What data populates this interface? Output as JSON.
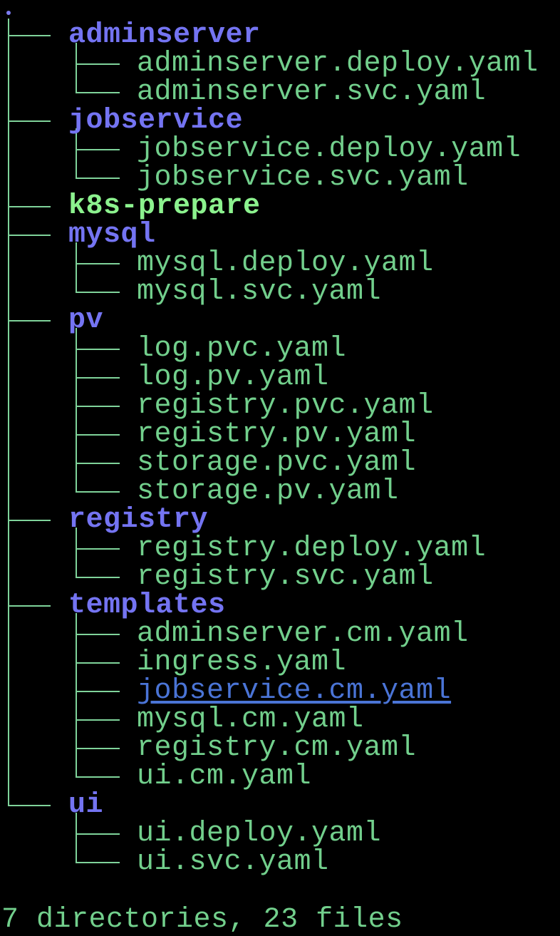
{
  "tree": {
    "root": ".",
    "entries": [
      {
        "depth": 0,
        "name": "adminserver",
        "kind": "dir",
        "last": false
      },
      {
        "depth": 1,
        "name": "adminserver.deploy.yaml",
        "kind": "file",
        "last": false
      },
      {
        "depth": 1,
        "name": "adminserver.svc.yaml",
        "kind": "file",
        "last": true
      },
      {
        "depth": 0,
        "name": "jobservice",
        "kind": "dir",
        "last": false
      },
      {
        "depth": 1,
        "name": "jobservice.deploy.yaml",
        "kind": "file",
        "last": false
      },
      {
        "depth": 1,
        "name": "jobservice.svc.yaml",
        "kind": "file",
        "last": true
      },
      {
        "depth": 0,
        "name": "k8s-prepare",
        "kind": "exec",
        "last": false
      },
      {
        "depth": 0,
        "name": "mysql",
        "kind": "dir",
        "last": false
      },
      {
        "depth": 1,
        "name": "mysql.deploy.yaml",
        "kind": "file",
        "last": false
      },
      {
        "depth": 1,
        "name": "mysql.svc.yaml",
        "kind": "file",
        "last": true
      },
      {
        "depth": 0,
        "name": "pv",
        "kind": "dir",
        "last": false
      },
      {
        "depth": 1,
        "name": "log.pvc.yaml",
        "kind": "file",
        "last": false
      },
      {
        "depth": 1,
        "name": "log.pv.yaml",
        "kind": "file",
        "last": false
      },
      {
        "depth": 1,
        "name": "registry.pvc.yaml",
        "kind": "file",
        "last": false
      },
      {
        "depth": 1,
        "name": "registry.pv.yaml",
        "kind": "file",
        "last": false
      },
      {
        "depth": 1,
        "name": "storage.pvc.yaml",
        "kind": "file",
        "last": false
      },
      {
        "depth": 1,
        "name": "storage.pv.yaml",
        "kind": "file",
        "last": true
      },
      {
        "depth": 0,
        "name": "registry",
        "kind": "dir",
        "last": false
      },
      {
        "depth": 1,
        "name": "registry.deploy.yaml",
        "kind": "file",
        "last": false
      },
      {
        "depth": 1,
        "name": "registry.svc.yaml",
        "kind": "file",
        "last": true
      },
      {
        "depth": 0,
        "name": "templates",
        "kind": "dir",
        "last": false
      },
      {
        "depth": 1,
        "name": "adminserver.cm.yaml",
        "kind": "file",
        "last": false
      },
      {
        "depth": 1,
        "name": "ingress.yaml",
        "kind": "file",
        "last": false
      },
      {
        "depth": 1,
        "name": "jobservice.cm.yaml",
        "kind": "link",
        "last": false
      },
      {
        "depth": 1,
        "name": "mysql.cm.yaml",
        "kind": "file",
        "last": false
      },
      {
        "depth": 1,
        "name": "registry.cm.yaml",
        "kind": "file",
        "last": false
      },
      {
        "depth": 1,
        "name": "ui.cm.yaml",
        "kind": "file",
        "last": true
      },
      {
        "depth": 0,
        "name": "ui",
        "kind": "dir",
        "last": true
      },
      {
        "depth": 1,
        "name": "ui.deploy.yaml",
        "kind": "file",
        "last": false
      },
      {
        "depth": 1,
        "name": "ui.svc.yaml",
        "kind": "file",
        "last": true
      }
    ]
  },
  "summary": "7 directories, 23 files",
  "colors": {
    "background": "#000000",
    "directory": "#7474f2",
    "file": "#72cf8c",
    "executable": "#8cf28e",
    "link": "#4a74d6",
    "tree_lines": "#7fd39a"
  }
}
